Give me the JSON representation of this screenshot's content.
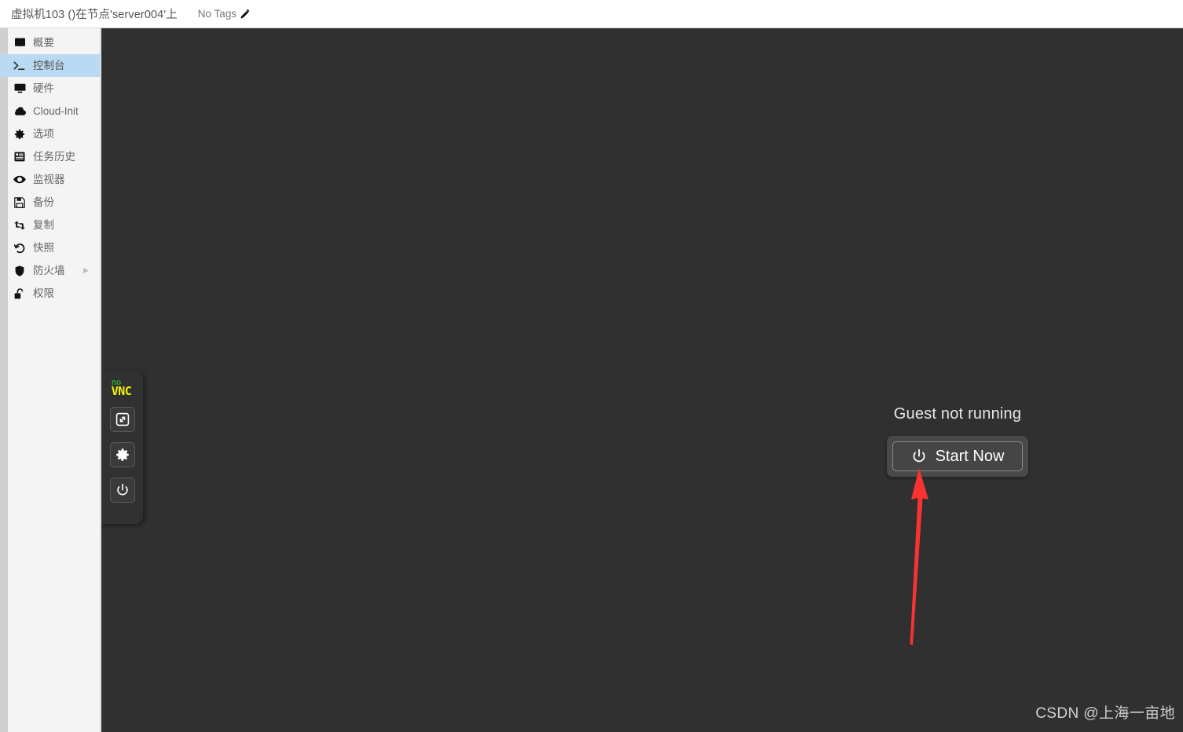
{
  "header": {
    "title": "虚拟机103 ()在节点'server004'上",
    "tags_label": "No Tags",
    "edit_icon": "pencil-icon"
  },
  "sidebar": {
    "items": [
      {
        "label": "概要",
        "icon": "book-icon",
        "selected": false,
        "has_chevron": false
      },
      {
        "label": "控制台",
        "icon": "terminal-icon",
        "selected": true,
        "has_chevron": false
      },
      {
        "label": "硬件",
        "icon": "monitor-icon",
        "selected": false,
        "has_chevron": false
      },
      {
        "label": "Cloud-Init",
        "icon": "cloud-icon",
        "selected": false,
        "has_chevron": false
      },
      {
        "label": "选项",
        "icon": "gear-icon",
        "selected": false,
        "has_chevron": false
      },
      {
        "label": "任务历史",
        "icon": "list-icon",
        "selected": false,
        "has_chevron": false
      },
      {
        "label": "监视器",
        "icon": "eye-icon",
        "selected": false,
        "has_chevron": false
      },
      {
        "label": "备份",
        "icon": "save-icon",
        "selected": false,
        "has_chevron": false
      },
      {
        "label": "复制",
        "icon": "retweet-icon",
        "selected": false,
        "has_chevron": false
      },
      {
        "label": "快照",
        "icon": "history-icon",
        "selected": false,
        "has_chevron": false
      },
      {
        "label": "防火墙",
        "icon": "shield-icon",
        "selected": false,
        "has_chevron": true
      },
      {
        "label": "权限",
        "icon": "unlock-icon",
        "selected": false,
        "has_chevron": false
      }
    ],
    "chevron_glyph": "▶"
  },
  "console": {
    "vnc_panel": {
      "logo_top": "no",
      "logo_bottom": "VNC",
      "logo_top_color": "#2e9c2e",
      "logo_bottom_color": "#f2f200",
      "buttons": [
        {
          "icon": "fullscreen-icon"
        },
        {
          "icon": "gear-icon"
        },
        {
          "icon": "power-icon"
        }
      ]
    },
    "guest": {
      "status_text": "Guest not running",
      "start_button_label": "Start Now",
      "start_button_icon": "power-icon"
    },
    "background_color": "#303030",
    "annotation_arrow_color": "#fa3232"
  },
  "watermark": {
    "text": "CSDN @上海一亩地"
  }
}
